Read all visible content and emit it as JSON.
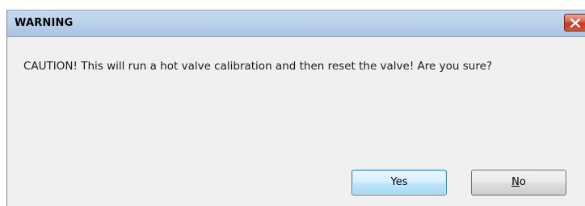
{
  "window": {
    "title": "WARNING"
  },
  "dialog": {
    "message": "CAUTION! This will run a hot valve calibration and then reset the valve! Are you sure?"
  },
  "buttons": {
    "yes_label": "Yes",
    "no_mnemonic": "N",
    "no_rest": "o"
  },
  "icons": {
    "close": "close-icon"
  },
  "colors": {
    "titlebar": "#b9d1ea",
    "close_button": "#c4371f",
    "default_button_border": "#3c7fb1",
    "dialog_background": "#f0f0f0"
  }
}
